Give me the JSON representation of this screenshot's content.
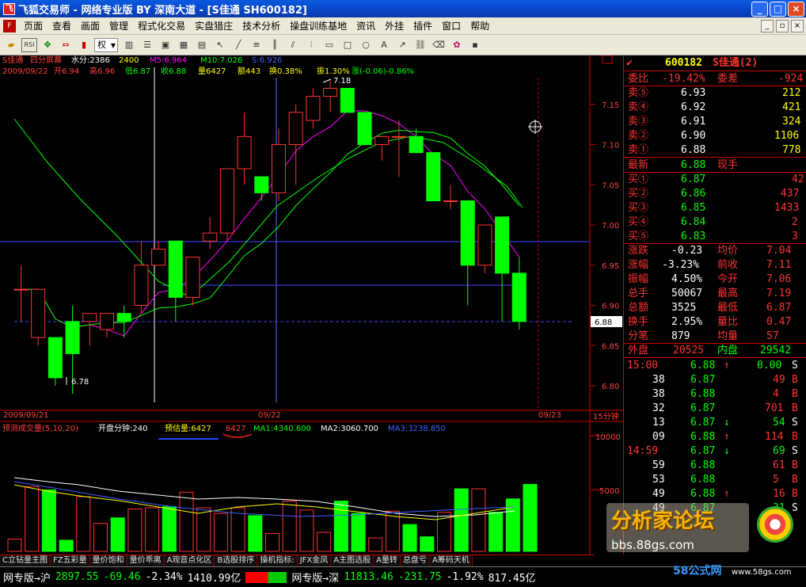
{
  "window": {
    "title": "飞狐交易师 - 网络专业版 BY 深南大道 - [S佳通 SH600182]",
    "min": "_",
    "max": "□",
    "close": "×"
  },
  "menu": [
    "页面",
    "查看",
    "画面",
    "管理",
    "程式化交易",
    "实盘猎庄",
    "技术分析",
    "操盘训练基地",
    "资讯",
    "外挂",
    "插件",
    "窗口",
    "帮助"
  ],
  "toolbar": {
    "select_value": "权"
  },
  "main": {
    "line1": {
      "name": "S佳通",
      "mode": "四分屏幕",
      "water": "水分:2386",
      "v": "2400",
      "ma5": "M5:6.964",
      "ma10": "M10:7.026",
      "ma20": "S:6.926"
    },
    "line2": {
      "date": "2009/09/22",
      "open": "开6.94",
      "high": "高6.96",
      "low": "低6.87",
      "close": "收6.88",
      "vol": "量6427",
      "amt": "额443",
      "turn": "换0.38%",
      "amp": "振1.30%",
      "chg": "涨(-0.06)-0.86%"
    },
    "high_label": "7.18",
    "low_label": "6.78",
    "cur_price": "6.88",
    "dates": [
      "2009/09/21",
      "09/22",
      "09/23"
    ],
    "period": "15分钟"
  },
  "vol_panel": {
    "name": "预测成交量(5,10,20)",
    "open_min": "开盘分钟:240",
    "est": "预估量:6427",
    "v2": "6427",
    "ma1": "MA1:4340.600",
    "ma2": "MA2:3060.700",
    "ma3": "MA3:3238.850",
    "ticks": [
      "10000",
      "5000"
    ]
  },
  "chart_data": {
    "type": "candlestick",
    "yticks": [
      7.15,
      7.1,
      7.05,
      7.0,
      6.95,
      6.9,
      6.85,
      6.8
    ],
    "candles": [
      [
        6.92,
        6.95,
        6.88,
        6.92
      ],
      [
        6.86,
        6.92,
        6.85,
        6.92
      ],
      [
        6.86,
        6.86,
        6.8,
        6.81
      ],
      [
        6.88,
        6.9,
        6.79,
        6.84
      ],
      [
        6.88,
        6.89,
        6.85,
        6.89
      ],
      [
        6.87,
        6.89,
        6.86,
        6.89
      ],
      [
        6.89,
        6.9,
        6.86,
        6.88
      ],
      [
        6.9,
        6.98,
        6.89,
        6.95
      ],
      [
        6.95,
        6.98,
        6.95,
        6.97
      ],
      [
        6.98,
        6.98,
        6.88,
        6.91
      ],
      [
        6.91,
        6.96,
        6.9,
        6.96
      ],
      [
        6.98,
        7.01,
        6.97,
        6.99
      ],
      [
        6.99,
        7.07,
        6.98,
        7.07
      ],
      [
        7.07,
        7.14,
        7.05,
        7.11
      ],
      [
        7.06,
        7.06,
        7.03,
        7.04
      ],
      [
        7.04,
        7.12,
        7.03,
        7.1
      ],
      [
        7.1,
        7.15,
        7.05,
        7.14
      ],
      [
        7.13,
        7.17,
        7.12,
        7.16
      ],
      [
        7.16,
        7.18,
        7.14,
        7.17
      ],
      [
        7.17,
        7.17,
        7.14,
        7.14
      ],
      [
        7.14,
        7.14,
        7.1,
        7.1
      ],
      [
        7.1,
        7.11,
        7.08,
        7.11
      ],
      [
        7.11,
        7.13,
        7.06,
        7.11
      ],
      [
        7.11,
        7.12,
        7.09,
        7.09
      ],
      [
        7.09,
        7.09,
        7.03,
        7.03
      ],
      [
        7.03,
        7.05,
        7.02,
        7.03
      ],
      [
        7.03,
        7.03,
        6.9,
        6.95
      ],
      [
        6.95,
        7.0,
        6.94,
        7.0
      ],
      [
        7.01,
        7.01,
        6.88,
        6.94
      ],
      [
        6.94,
        6.96,
        6.87,
        6.88
      ]
    ],
    "volumes": [
      1100,
      5800,
      5500,
      1000,
      4900,
      2500,
      3000,
      3800,
      3900,
      4000,
      5300,
      3900,
      3400,
      3900,
      3200,
      1600,
      4500,
      3700,
      1700,
      4500,
      3400,
      1200,
      3600,
      2400,
      1300,
      3500,
      5600,
      5600,
      3500,
      4700,
      6000
    ]
  },
  "quote": {
    "code": "600182",
    "name": "S佳通",
    "num": "(2)",
    "wb_label": "委比",
    "wb": "-19.42%",
    "wc_label": "委差",
    "wc": "-924",
    "asks": [
      {
        "l": "卖⑤",
        "p": "6.93",
        "v": "212"
      },
      {
        "l": "卖④",
        "p": "6.92",
        "v": "421"
      },
      {
        "l": "卖③",
        "p": "6.91",
        "v": "324"
      },
      {
        "l": "卖②",
        "p": "6.90",
        "v": "1106"
      },
      {
        "l": "卖①",
        "p": "6.88",
        "v": "778"
      }
    ],
    "last_label": "最新",
    "last": "6.88",
    "now_label": "现手",
    "bids": [
      {
        "l": "买①",
        "p": "6.87",
        "v": "42"
      },
      {
        "l": "买②",
        "p": "6.86",
        "v": "437"
      },
      {
        "l": "买③",
        "p": "6.85",
        "v": "1433"
      },
      {
        "l": "买④",
        "p": "6.84",
        "v": "2"
      },
      {
        "l": "买⑤",
        "p": "6.83",
        "v": "3"
      }
    ],
    "stats": [
      [
        "涨跌",
        "-0.23",
        "均价",
        "7.04"
      ],
      [
        "涨幅",
        "-3.23%",
        "前收",
        "7.11"
      ],
      [
        "振幅",
        "4.50%",
        "今开",
        "7.06"
      ],
      [
        "总手",
        "50067",
        "最高",
        "7.19"
      ],
      [
        "总额",
        "3525",
        "最低",
        "6.87"
      ],
      [
        "换手",
        "2.95%",
        "量比",
        "0.47"
      ],
      [
        "分笔",
        "879",
        "均量",
        "57"
      ]
    ],
    "outer_label": "外盘",
    "outer": "20525",
    "inner_label": "内盘",
    "inner": "29542",
    "ticks": [
      {
        "t": "15:00",
        "p": "6.88",
        "a": "↑",
        "v": "0.00",
        "s": "S"
      },
      {
        "t": "38",
        "p": "6.87",
        "a": "",
        "v": "49",
        "s": "B"
      },
      {
        "t": "38",
        "p": "6.88",
        "a": "",
        "v": "4",
        "s": "B"
      },
      {
        "t": "32",
        "p": "6.87",
        "a": "",
        "v": "701",
        "s": "B"
      },
      {
        "t": "13",
        "p": "6.87",
        "a": "↓",
        "v": "54",
        "s": "S"
      },
      {
        "t": "09",
        "p": "6.88",
        "a": "↑",
        "v": "114",
        "s": "B"
      },
      {
        "t": "14:59",
        "p": "6.87",
        "a": "↓",
        "v": "69",
        "s": "S"
      },
      {
        "t": "59",
        "p": "6.88",
        "a": "",
        "v": "61",
        "s": "B"
      },
      {
        "t": "53",
        "p": "6.88",
        "a": "",
        "v": "5",
        "s": "B"
      },
      {
        "t": "49",
        "p": "6.88",
        "a": "↑",
        "v": "16",
        "s": "B"
      },
      {
        "t": "49",
        "p": "6.87",
        "a": "",
        "v": "31",
        "s": "S"
      }
    ]
  },
  "bottom_tabs": [
    "C立钻量主图",
    "FZ五彩量",
    "量价饱和",
    "量价乖离",
    "A观音点化区",
    "B选股排序",
    "操机指标:",
    "JFX金凤",
    "A主图选股",
    "A量转",
    "总盘亏",
    "A筹码天机"
  ],
  "ticker": {
    "sh_label": "网专版→沪",
    "sh_idx": "2897.55",
    "sh_chg": "-69.46",
    "sh_pct": "-2.34%",
    "sh_amt": "1410.99亿",
    "sz_label": "网专版→深",
    "sz_idx": "11813.46",
    "sz_chg": "-231.75",
    "sz_pct": "-1.92%",
    "sz_amt": "817.45亿"
  },
  "watermark": {
    "forum": "分析家论坛",
    "url": "bbs.88gs.com",
    "site": "58公式网",
    "url2": "www.58gs.com"
  },
  "colors": {
    "up": "#ff3232",
    "down": "#00ff00",
    "bg": "#000000",
    "grid": "#a00000",
    "ma5": "#ff00ff",
    "ma10": "#00ff00",
    "label": "#ffff00"
  }
}
